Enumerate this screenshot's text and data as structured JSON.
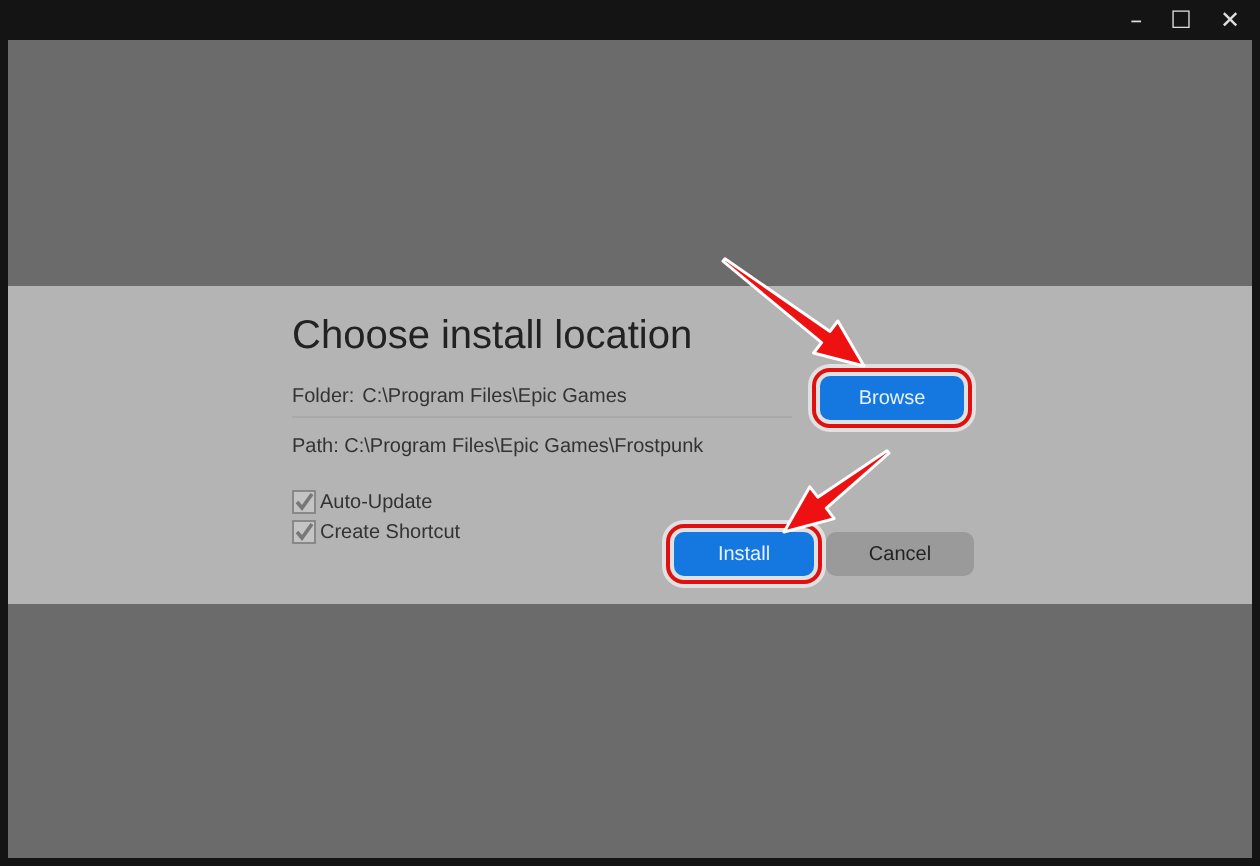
{
  "window": {
    "controls": [
      "–",
      "☐",
      "✕"
    ]
  },
  "dialog": {
    "title": "Choose install location",
    "folder": {
      "label": "Folder:",
      "value": "C:\\Program Files\\Epic Games"
    },
    "path": {
      "label": "Path:",
      "value": "C:\\Program Files\\Epic Games\\Frostpunk"
    },
    "options": [
      {
        "label": "Auto-Update",
        "checked": true
      },
      {
        "label": "Create Shortcut",
        "checked": true
      }
    ],
    "browse": {
      "label": "Browse",
      "highlighted": true
    },
    "buttons": [
      {
        "label": "Install",
        "kind": "primary",
        "highlighted": true
      },
      {
        "label": "Cancel",
        "kind": "secondary",
        "highlighted": false
      }
    ]
  }
}
